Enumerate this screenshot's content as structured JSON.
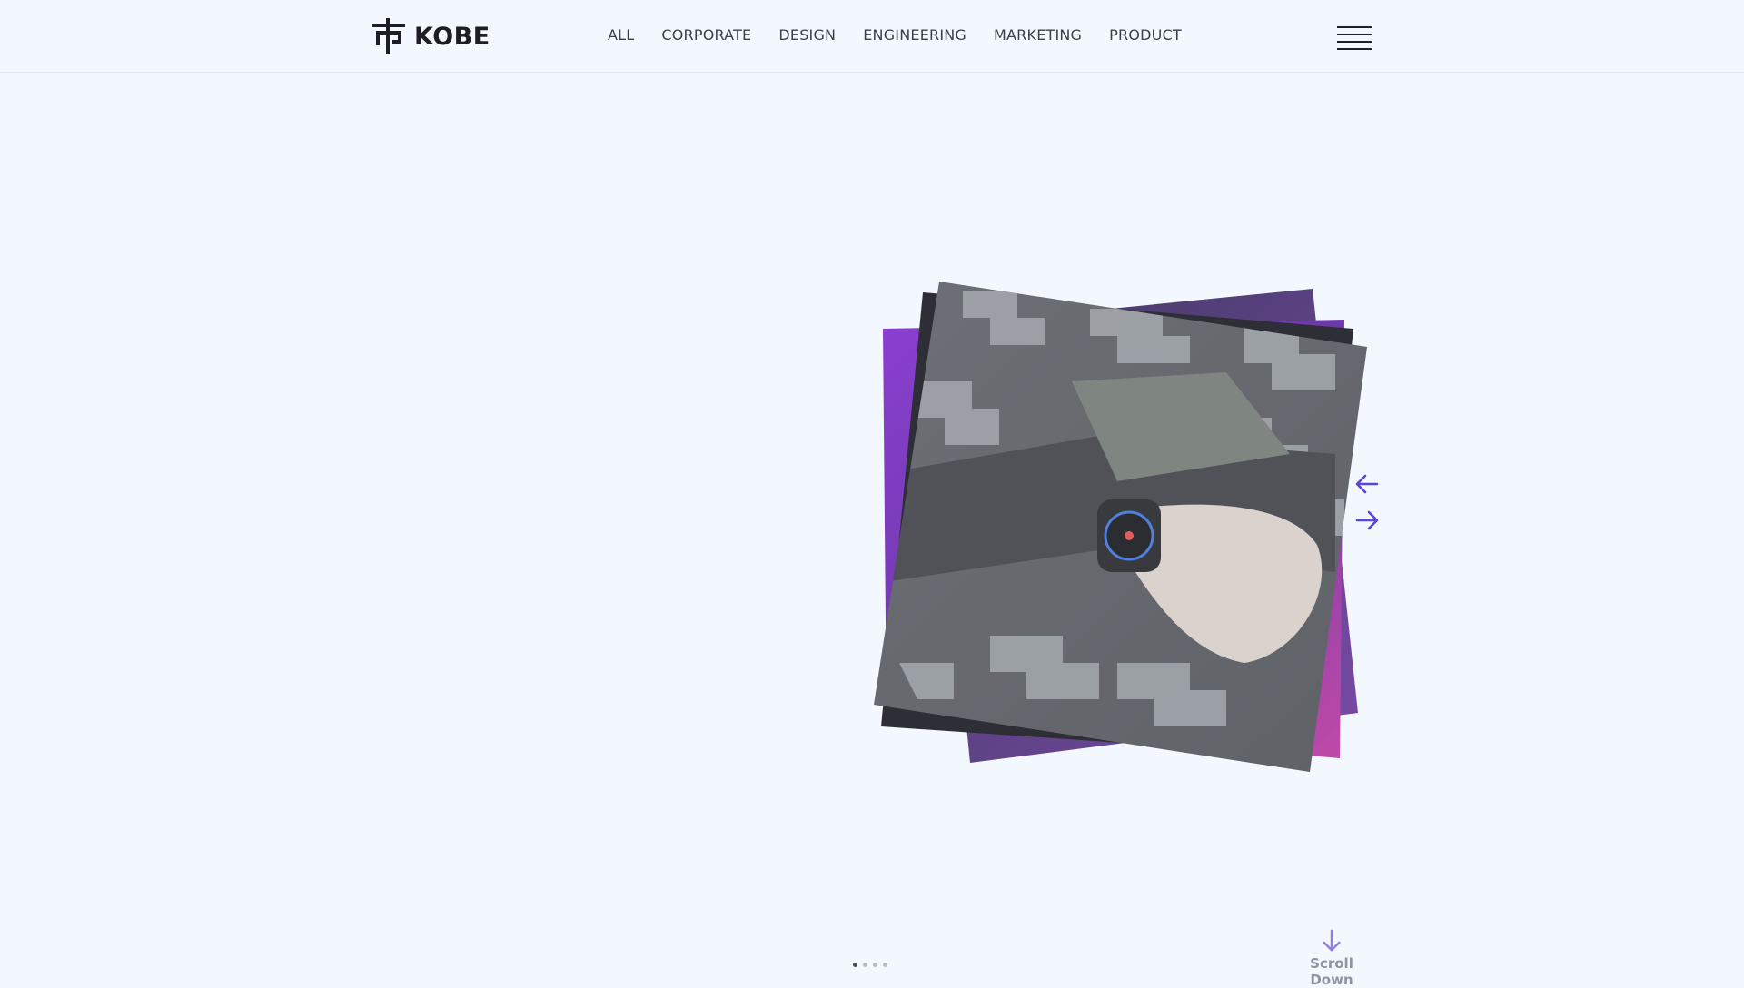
{
  "brand": {
    "name": "KOBE"
  },
  "nav": {
    "items": [
      "ALL",
      "CORPORATE",
      "DESIGN",
      "ENGINEERING",
      "MARKETING",
      "PRODUCT"
    ]
  },
  "menu_icon": "hamburger-menu-icon",
  "slider": {
    "prev_icon": "arrow-left-icon",
    "next_icon": "arrow-right-icon",
    "total_slides": 4,
    "active_index": 0,
    "accent_color": "#5b45d6"
  },
  "scroll": {
    "label": "Scroll Down",
    "icon": "arrow-down-icon",
    "color": "#8e7fe0"
  },
  "colors": {
    "background": "#f3f7fe",
    "text": "#3b3f4a",
    "accent": "#5b45d6"
  }
}
